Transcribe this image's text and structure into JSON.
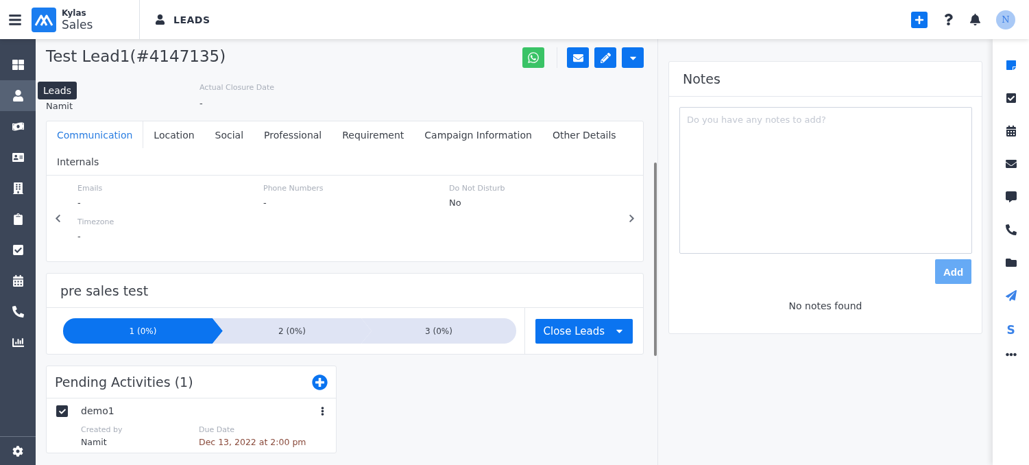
{
  "header": {
    "brand_top": "Kylas",
    "brand_bottom": "Sales",
    "section": "LEADS",
    "avatar": "N"
  },
  "sidebar": [
    {
      "selected": false
    },
    {
      "selected": true
    },
    {
      "selected": false
    },
    {
      "selected": false
    },
    {
      "selected": false
    },
    {
      "selected": false
    },
    {
      "selected": false
    },
    {
      "selected": false
    },
    {
      "selected": false
    },
    {
      "selected": false
    }
  ],
  "tooltip": "Leads",
  "lead": {
    "title": "Test Lead1(#4147135)",
    "owner_value": "Namit",
    "closure_label": "Actual Closure Date",
    "closure_value": "-"
  },
  "tabs": [
    {
      "label": "Communication",
      "selected": true
    },
    {
      "label": "Location",
      "selected": false
    },
    {
      "label": "Social",
      "selected": false
    },
    {
      "label": "Professional",
      "selected": false
    },
    {
      "label": "Requirement",
      "selected": false
    },
    {
      "label": "Campaign Information",
      "selected": false
    },
    {
      "label": "Other Details",
      "selected": false
    },
    {
      "label": "Internals",
      "selected": false
    }
  ],
  "communication": [
    {
      "label": "Emails",
      "value": "-"
    },
    {
      "label": "Phone Numbers",
      "value": "-"
    },
    {
      "label": "Do Not Disturb",
      "value": "No"
    },
    {
      "label": "Timezone",
      "value": "-"
    }
  ],
  "pipeline": {
    "name": "pre sales test",
    "stages": [
      {
        "label": "1 (0%)",
        "selected": true
      },
      {
        "label": "2 (0%)",
        "selected": false
      },
      {
        "label": "3 (0%)",
        "selected": false
      }
    ],
    "action": "Close Leads"
  },
  "activities": {
    "title": "Pending Activities (1)",
    "items": [
      {
        "name": "demo1",
        "checked": true,
        "created_by_label": "Created by",
        "created_by": "Namit",
        "due_label": "Due Date",
        "due": "Dec 13, 2022 at 2:00 pm"
      }
    ]
  },
  "notes": {
    "title": "Notes",
    "placeholder": "Do you have any notes to add?",
    "button": "Add",
    "empty": "No notes found"
  },
  "rail_letter": "S"
}
